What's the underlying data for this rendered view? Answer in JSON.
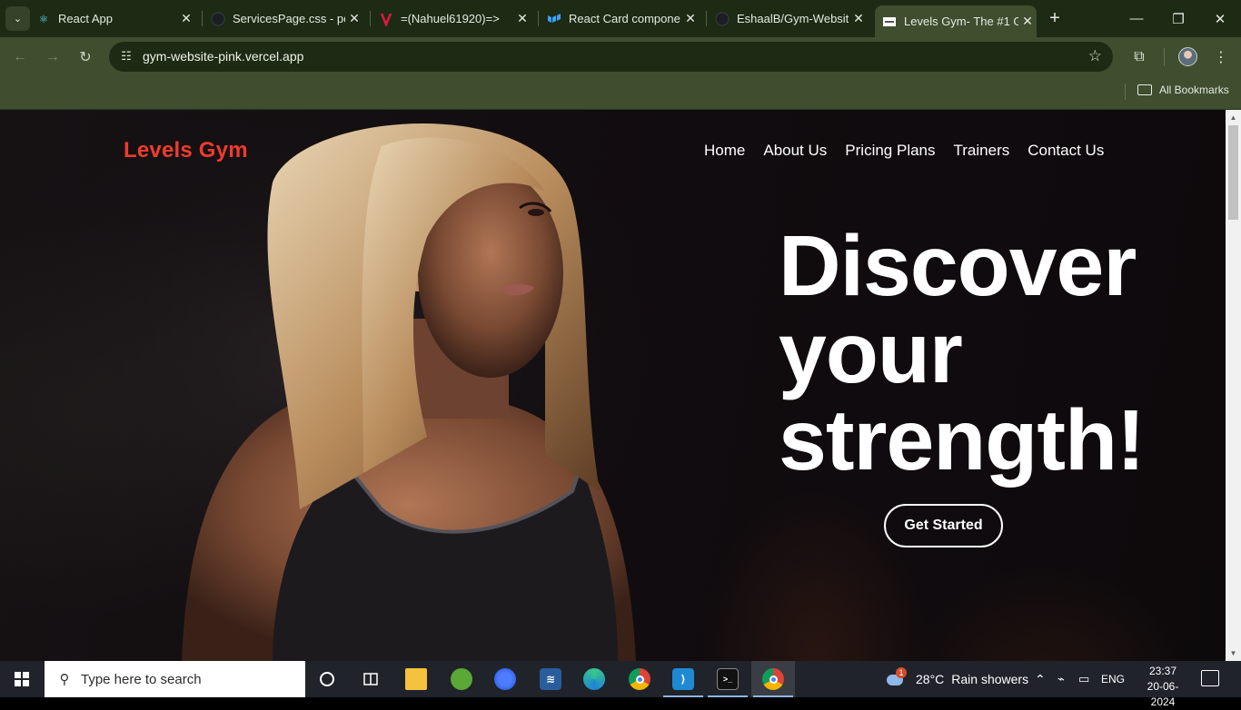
{
  "browser": {
    "tabs": [
      {
        "title": "React App",
        "icon": "react-icon"
      },
      {
        "title": "ServicesPage.css - po",
        "icon": "github-icon"
      },
      {
        "title": "=(Nahuel61920)=>",
        "icon": "nahuel-logo-icon"
      },
      {
        "title": "React Card compone",
        "icon": "mui-icon"
      },
      {
        "title": "EshaalB/Gym-Websit",
        "icon": "github-icon"
      },
      {
        "title": "Levels Gym- The #1 G",
        "icon": "site-favicon"
      }
    ],
    "active_tab_index": 5,
    "url": "gym-website-pink.vercel.app",
    "all_bookmarks_label": "All Bookmarks"
  },
  "site": {
    "brand": "Levels Gym",
    "brand_color": "#ef3b2d",
    "nav": [
      "Home",
      "About Us",
      "Pricing Plans",
      "Trainers",
      "Contact Us"
    ],
    "hero": {
      "lines": [
        "Discover",
        "your",
        "strength!"
      ],
      "cta_label": "Get Started"
    }
  },
  "taskbar": {
    "search_placeholder": "Type here to search",
    "apps": [
      "cortana-icon",
      "task-view-icon",
      "file-explorer-icon",
      "app-green-icon",
      "firefox-icon",
      "sql-dev-icon",
      "edge-icon",
      "chrome-icon",
      "vscode-icon",
      "terminal-icon",
      "chrome-icon"
    ],
    "weather": {
      "temp": "28°C",
      "desc": "Rain showers",
      "badge": "1"
    },
    "language": "ENG",
    "time": "23:37",
    "date": "20-06-2024"
  }
}
